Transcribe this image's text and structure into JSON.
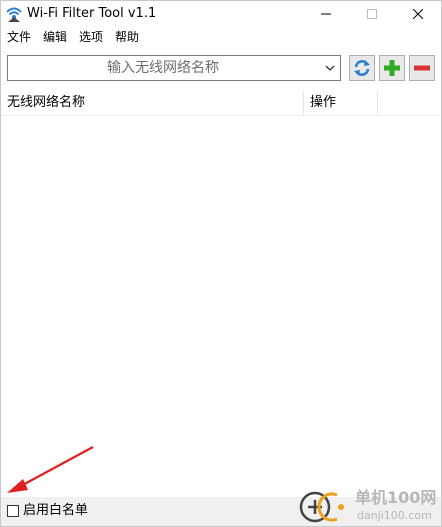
{
  "window": {
    "title": "Wi-Fi Filter Tool v1.1"
  },
  "menu": {
    "items": [
      {
        "label": "文件"
      },
      {
        "label": "编辑"
      },
      {
        "label": "选项"
      },
      {
        "label": "帮助"
      }
    ]
  },
  "toolbar": {
    "combo_placeholder": "输入无线网络名称",
    "refresh_icon": "refresh-icon",
    "add_icon": "plus-icon",
    "remove_icon": "minus-icon",
    "colors": {
      "refresh": "#2a7fd4",
      "add": "#2eab1f",
      "remove": "#d9352e"
    }
  },
  "list": {
    "columns": [
      {
        "label": "无线网络名称"
      },
      {
        "label": "操作"
      }
    ],
    "rows": []
  },
  "status": {
    "whitelist_label": "启用白名单",
    "whitelist_checked": false
  },
  "annotation": {
    "arrow_color": "#e02020"
  },
  "watermark": {
    "brand": "单机100网",
    "url": "danji100.com"
  }
}
